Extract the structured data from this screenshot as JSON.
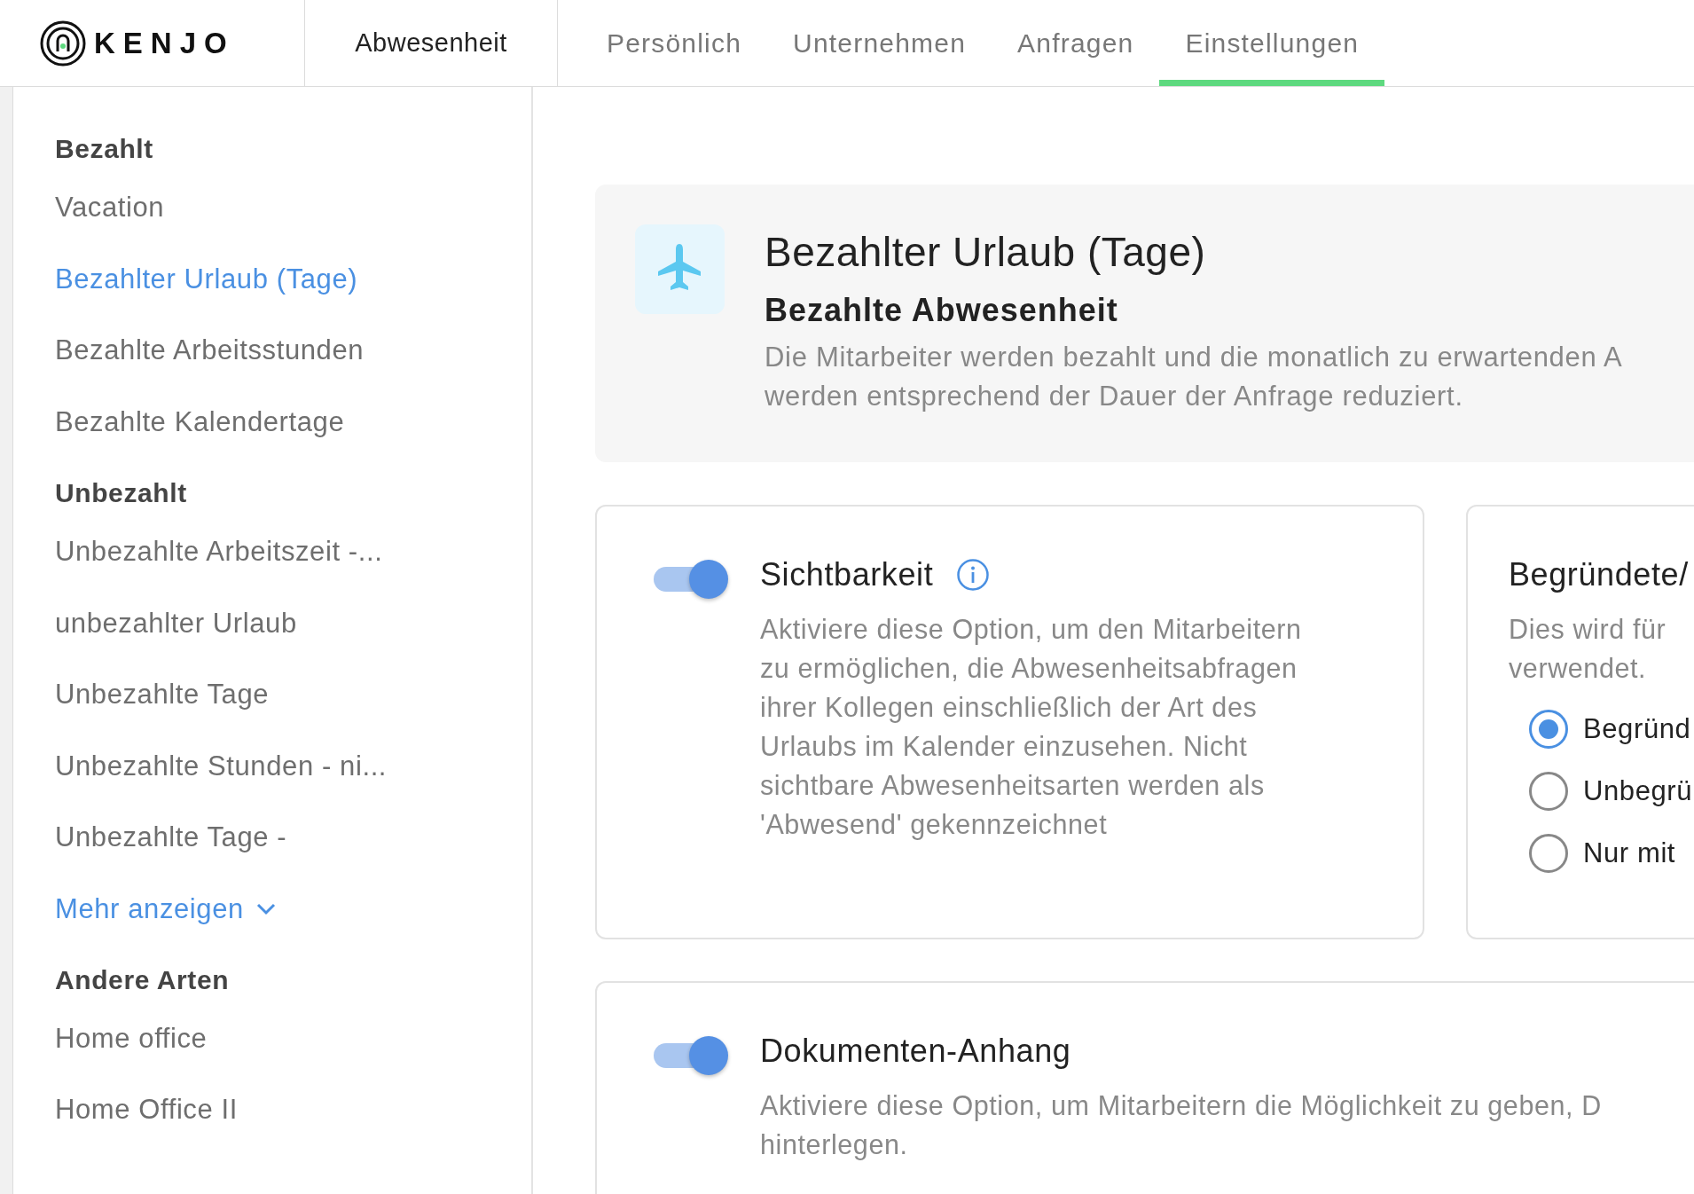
{
  "header": {
    "logo": "KENJO",
    "section": "Abwesenheit",
    "tabs": [
      {
        "label": "Persönlich",
        "selected": false
      },
      {
        "label": "Unternehmen",
        "selected": false
      },
      {
        "label": "Anfragen",
        "selected": false
      },
      {
        "label": "Einstellungen",
        "selected": true
      }
    ]
  },
  "sidebar": {
    "groups": [
      {
        "title": "Bezahlt",
        "items": [
          {
            "label": "Vacation",
            "selected": false
          },
          {
            "label": "Bezahlter Urlaub (Tage)",
            "selected": true
          },
          {
            "label": "Bezahlte Arbeitsstunden",
            "selected": false
          },
          {
            "label": "Bezahlte Kalendertage",
            "selected": false
          }
        ]
      },
      {
        "title": "Unbezahlt",
        "items": [
          {
            "label": "Unbezahlte Arbeitszeit -...",
            "selected": false
          },
          {
            "label": "unbezahlter Urlaub",
            "selected": false
          },
          {
            "label": "Unbezahlte Tage",
            "selected": false
          },
          {
            "label": "Unbezahlte Stunden - ni...",
            "selected": false
          },
          {
            "label": "Unbezahlte Tage -",
            "selected": false
          }
        ],
        "more": "Mehr anzeigen"
      },
      {
        "title": "Andere Arten",
        "items": [
          {
            "label": "Home office",
            "selected": false
          },
          {
            "label": "Home Office II",
            "selected": false
          }
        ]
      }
    ]
  },
  "summary": {
    "title": "Bezahlter Urlaub (Tage)",
    "subtitle": "Bezahlte Abwesenheit",
    "description": [
      "Die Mitarbeiter werden bezahlt und die monatlich zu erwartenden A",
      "werden entsprechend der Dauer der Anfrage reduziert."
    ]
  },
  "visibility": {
    "title": "Sichtbarkeit",
    "on": true,
    "description": [
      "Aktiviere diese Option, um den Mitarbeitern",
      "zu ermöglichen, die Abwesenheitsabfragen",
      "ihrer Kollegen einschließlich der Art des",
      "Urlaubs im Kalender einzusehen. Nicht",
      "sichtbare Abwesenheitsarten werden als",
      "'Abwesend' gekennzeichnet"
    ]
  },
  "reason": {
    "title": "Begründete/",
    "description": [
      "Dies wird für",
      "verwendet."
    ],
    "options": [
      {
        "label": "Begründ",
        "selected": true
      },
      {
        "label": "Unbegrü",
        "selected": false
      },
      {
        "label": "Nur mit",
        "selected": false
      }
    ]
  },
  "attachment": {
    "title": "Dokumenten-Anhang",
    "on": true,
    "description": [
      "Aktiviere diese Option, um Mitarbeitern die Möglichkeit zu geben, D",
      "hinterlegen."
    ]
  }
}
